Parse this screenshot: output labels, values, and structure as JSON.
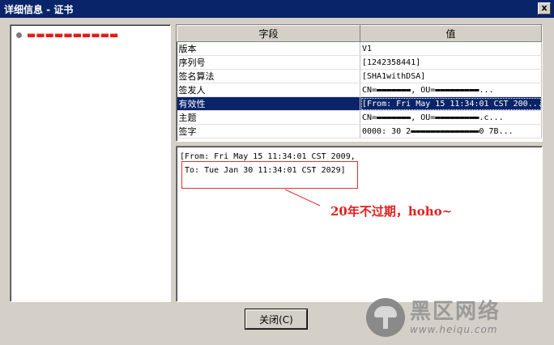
{
  "window": {
    "title": "详细信息 - 证书",
    "close_glyph": "x"
  },
  "tree": {
    "items": [
      {
        "label": "▬▬▬▬▬▬▬▬▬▬"
      }
    ]
  },
  "fields": {
    "headers": {
      "field": "字段",
      "value": "值"
    },
    "rows": [
      {
        "field": "版本",
        "value": "V1"
      },
      {
        "field": "序列号",
        "value": "[1242358441]"
      },
      {
        "field": "签名算法",
        "value": "[SHA1withDSA]"
      },
      {
        "field": "签发人",
        "value": "CN=▬▬▬▬▬▬▬, OU=▬▬▬▬▬▬▬▬▬..."
      },
      {
        "field": "有效性",
        "value": "[From: Fri May 15 11:34:01 CST 200..."
      },
      {
        "field": "主题",
        "value": "CN=▬▬▬▬▬▬▬, OU=▬▬▬▬▬▬▬▬▬.c..."
      },
      {
        "field": "签字",
        "value": "0000: 30 2▬▬▬▬▬▬▬▬▬▬▬▬▬▬0  7B..."
      }
    ]
  },
  "detail": {
    "line1": "[From: Fri May 15 11:34:01 CST 2009,",
    "line2": " To: Tue Jan 30 11:34:01 CST 2029]"
  },
  "annotation": {
    "text": "20年不过期，hoho~",
    "color": "#e02020"
  },
  "buttons": {
    "close": "关闭(C)"
  },
  "watermark": {
    "cn": "黑区网络",
    "url": "www.heiqu.com"
  },
  "colors": {
    "title_bar": "#0a246a",
    "selection": "#0a246a",
    "chrome": "#d4d0c8",
    "redaction": "#e81a1a"
  }
}
